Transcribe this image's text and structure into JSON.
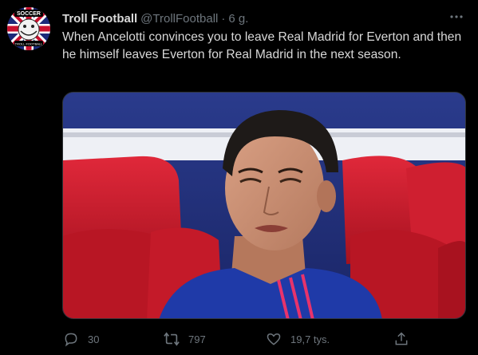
{
  "tweet": {
    "author": {
      "display_name": "Troll Football",
      "handle": "@TrollFootball",
      "separator": "·",
      "time": "6 g.",
      "avatar_icon": "troll-face-union-jack-avatar",
      "avatar_text_top": "SOCCER",
      "avatar_text_bottom": "TROLL FOOTBALL"
    },
    "text": "When Ancelotti convinces you to leave Real Madrid for Everton and then he himself leaves Everton for Real Madrid in the next season.",
    "media": {
      "description_icon": "crying-player-photo"
    },
    "actions": {
      "reply": {
        "icon": "reply-icon",
        "count": "30"
      },
      "retweet": {
        "icon": "retweet-icon",
        "count": "797"
      },
      "like": {
        "icon": "like-icon",
        "count": "19,7 tys."
      },
      "share": {
        "icon": "share-icon"
      }
    },
    "more_icon": "more-icon"
  },
  "colors": {
    "background": "#000000",
    "text": "#d9d9d9",
    "secondary": "#6e767d",
    "border": "#2f3336"
  }
}
